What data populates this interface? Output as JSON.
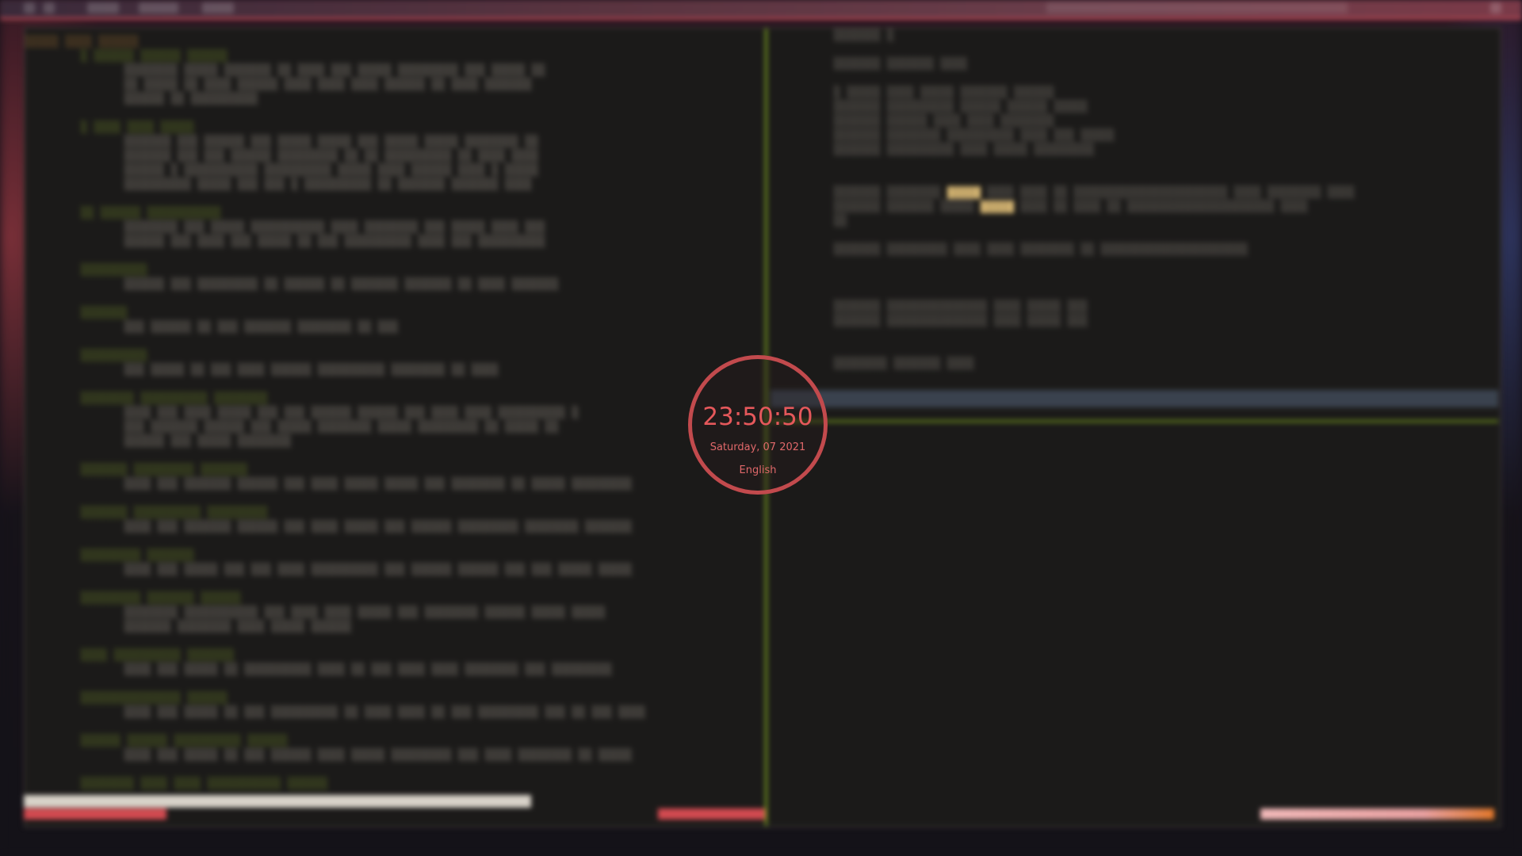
{
  "lock": {
    "time": "23:50:50",
    "date": "Saturday, 07 2021",
    "layout": "English"
  },
  "colors": {
    "ring": "#c24a4d",
    "text": "#e5585b",
    "split": "#7aa020",
    "status_red": "#d24a50"
  }
}
